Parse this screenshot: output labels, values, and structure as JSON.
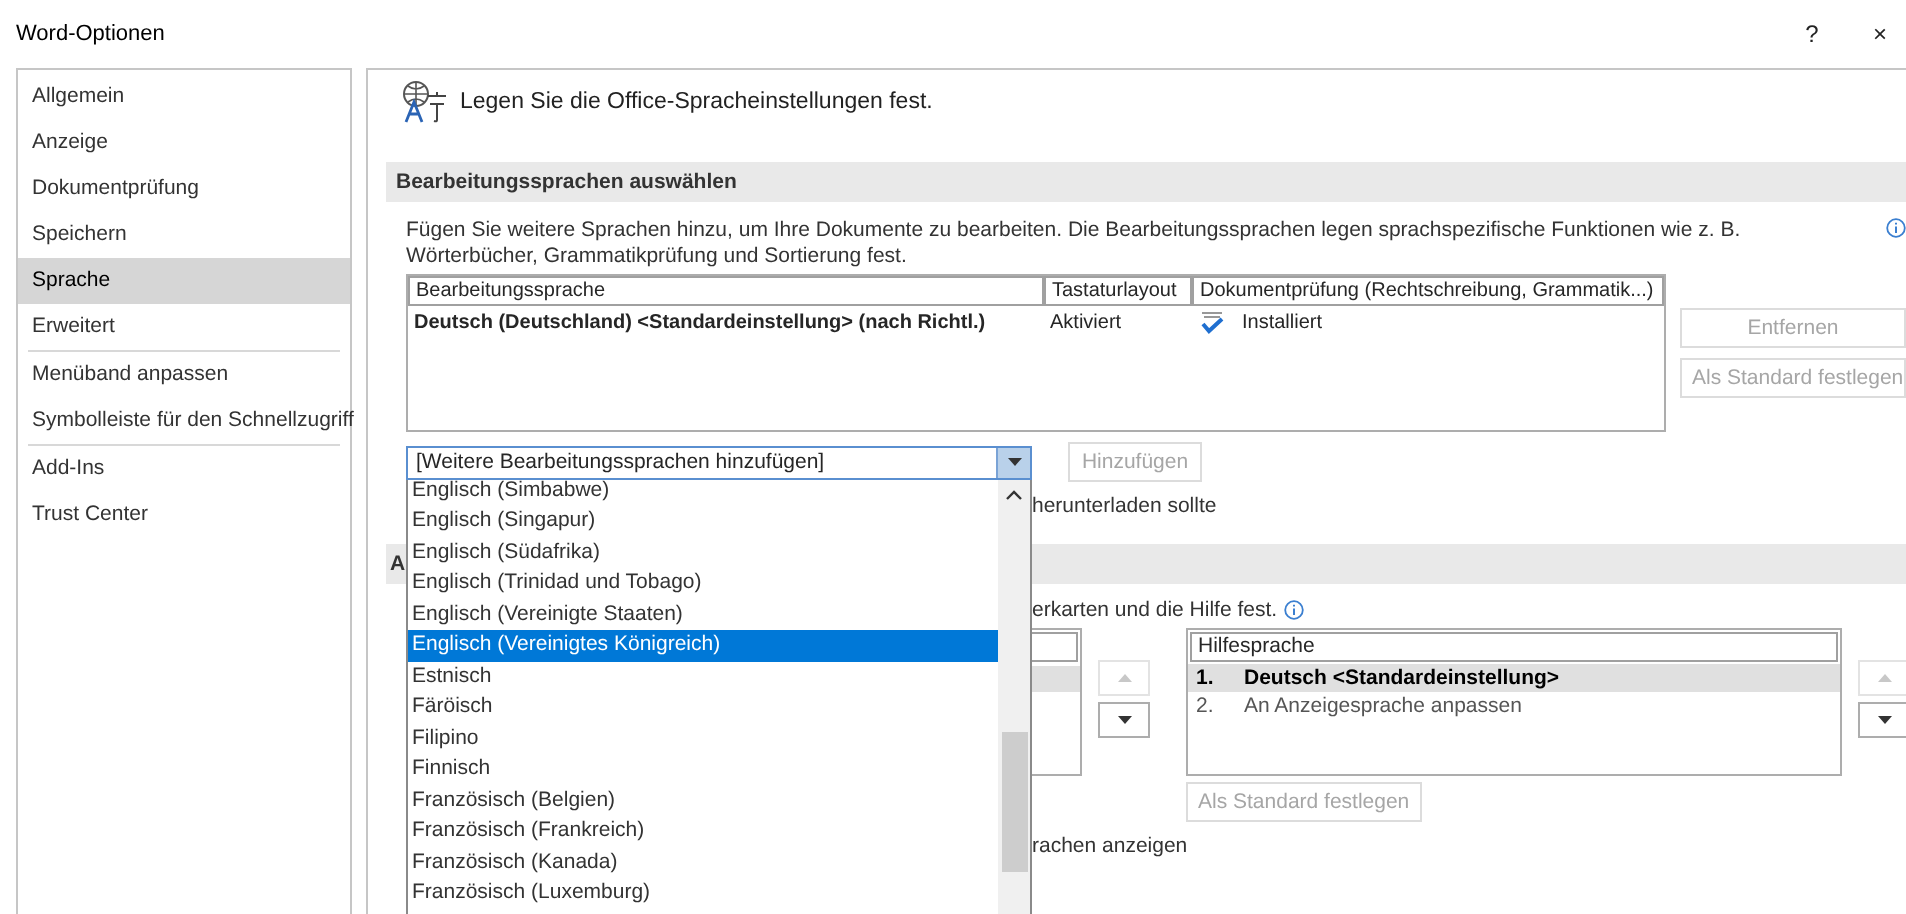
{
  "window": {
    "title": "Word-Optionen",
    "help": "?",
    "close": "×"
  },
  "sidebar": {
    "groups": [
      {
        "items": [
          {
            "label": "Allgemein",
            "selected": false
          },
          {
            "label": "Anzeige",
            "selected": false
          },
          {
            "label": "Dokumentprüfung",
            "selected": false
          },
          {
            "label": "Speichern",
            "selected": false
          },
          {
            "label": "Sprache",
            "selected": true
          },
          {
            "label": "Erweitert",
            "selected": false
          }
        ]
      },
      {
        "items": [
          {
            "label": "Menüband anpassen",
            "selected": false
          },
          {
            "label": "Symbolleiste für den Schnellzugriff",
            "selected": false
          }
        ]
      },
      {
        "items": [
          {
            "label": "Add-Ins",
            "selected": false
          },
          {
            "label": "Trust Center",
            "selected": false
          }
        ]
      }
    ]
  },
  "header": {
    "text": "Legen Sie die Office-Spracheinstellungen fest."
  },
  "editing_languages": {
    "title": "Bearbeitungssprachen auswählen",
    "description": "Fügen Sie weitere Sprachen hinzu, um Ihre Dokumente zu bearbeiten. Die Bearbeitungssprachen legen sprachspezifische Funktionen wie z. B. Wörterbücher, Grammatikprüfung und Sortierung fest.",
    "table": {
      "columns": [
        "Bearbeitungssprache",
        "Tastaturlayout",
        "Dokumentprüfung (Rechtschreibung, Grammatik...)"
      ],
      "rows": [
        {
          "language": "Deutsch (Deutschland) <Standardeinstellung> (nach Richtl.)",
          "keyboard": "Aktiviert",
          "proofing": "Installiert",
          "proofing_installed": true
        }
      ]
    },
    "buttons": [
      {
        "label": "Entfernen",
        "disabled": true
      },
      {
        "label": "Als Standard festlegen",
        "disabled": true
      }
    ],
    "combo": {
      "value": "[Weitere Bearbeitungssprachen hinzufügen]",
      "expanded": true
    },
    "add_button": {
      "label": "Hinzufügen",
      "disabled": true
    },
    "note": "herunterladen sollte"
  },
  "dropdown": {
    "items": [
      {
        "label": "Englisch (Simbabwe)",
        "selected": false
      },
      {
        "label": "Englisch (Singapur)",
        "selected": false
      },
      {
        "label": "Englisch (Südafrika)",
        "selected": false
      },
      {
        "label": "Englisch (Trinidad und Tobago)",
        "selected": false
      },
      {
        "label": "Englisch (Vereinigte Staaten)",
        "selected": false
      },
      {
        "label": "Englisch (Vereinigtes Königreich)",
        "selected": true
      },
      {
        "label": "Estnisch",
        "selected": false
      },
      {
        "label": "Färöisch",
        "selected": false
      },
      {
        "label": "Filipino",
        "selected": false
      },
      {
        "label": "Finnisch",
        "selected": false
      },
      {
        "label": "Französisch (Belgien)",
        "selected": false
      },
      {
        "label": "Französisch (Frankreich)",
        "selected": false
      },
      {
        "label": "Französisch (Kanada)",
        "selected": false
      },
      {
        "label": "Französisch (Luxemburg)",
        "selected": false
      }
    ]
  },
  "display_languages": {
    "title": "A",
    "description": "erkarten und die Hilfe fest.",
    "move_buttons": [
      {
        "kind": "up",
        "disabled": true
      },
      {
        "kind": "down",
        "disabled": false
      }
    ],
    "help_list": {
      "header": "Hilfesprache",
      "rows": [
        {
          "number": "1.",
          "label": "Deutsch <Standardeinstellung>",
          "selected": true
        },
        {
          "number": "2.",
          "label": "An Anzeigesprache anpassen",
          "selected": false
        }
      ]
    },
    "help_move_buttons": [
      {
        "kind": "up",
        "disabled": true
      },
      {
        "kind": "down",
        "disabled": false
      }
    ],
    "default_button": {
      "label": "Als Standard festlegen",
      "disabled": true
    },
    "note": "rachen anzeigen"
  }
}
